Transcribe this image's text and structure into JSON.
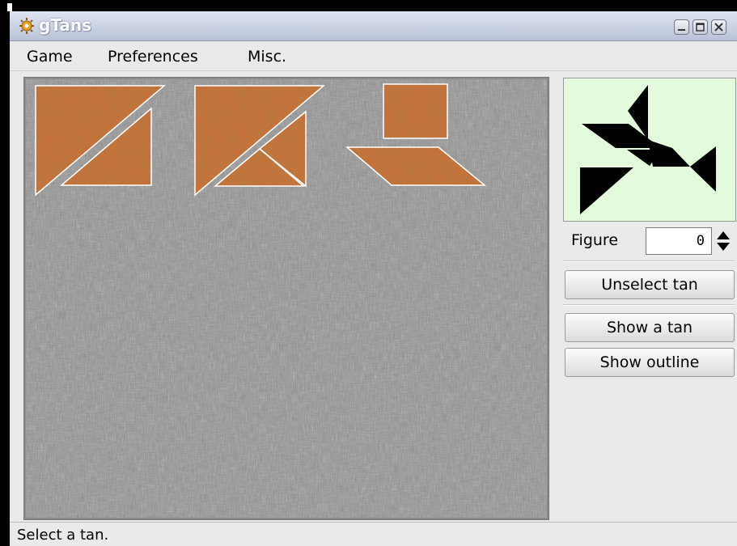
{
  "window": {
    "title": "gTans",
    "controls": [
      "minimize",
      "maximize",
      "close"
    ]
  },
  "menu": {
    "items": [
      {
        "label": "Game"
      },
      {
        "label": "Preferences"
      },
      {
        "label": "Misc."
      }
    ]
  },
  "side_panel": {
    "figure_label": "Figure",
    "figure_value": "0",
    "buttons": {
      "unselect": "Unselect tan",
      "show_tan": "Show a tan",
      "show_outline": "Show outline"
    }
  },
  "status": {
    "text": "Select a tan."
  },
  "colors": {
    "preview_bg": "#e3fadc",
    "tan_wood": "#c8703a",
    "board_metal": "#8a8a8a"
  },
  "icons": {
    "app": "gtans-gear-icon",
    "spin": "spin-up-down-icon"
  }
}
